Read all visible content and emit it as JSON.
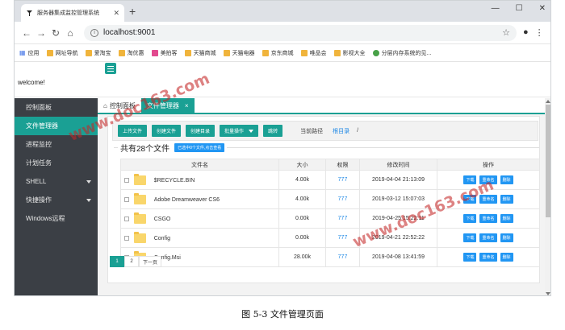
{
  "browser": {
    "tab_title": "服务器集成监控管理系统",
    "new_tab": "+",
    "url": "localhost:9001",
    "window_controls": [
      "—",
      "☐",
      "✕"
    ],
    "bookmarks": [
      {
        "label": "应用",
        "icon": "apps-grid-icon"
      },
      {
        "label": "网址导航",
        "icon": "folder-icon"
      },
      {
        "label": "爱淘宝",
        "icon": "folder-icon"
      },
      {
        "label": "淘优惠",
        "icon": "folder-icon"
      },
      {
        "label": "美拍客",
        "icon": "pink-square-icon"
      },
      {
        "label": "天猫商城",
        "icon": "folder-icon"
      },
      {
        "label": "天猫电器",
        "icon": "folder-icon"
      },
      {
        "label": "京东商城",
        "icon": "folder-icon"
      },
      {
        "label": "唯品会",
        "icon": "folder-icon"
      },
      {
        "label": "影视大全",
        "icon": "folder-icon"
      },
      {
        "label": "分层内存系统的见...",
        "icon": "green-circle-icon"
      }
    ]
  },
  "header": {
    "welcome": "welcome!"
  },
  "sidebar": {
    "items": [
      {
        "label": "控制面板"
      },
      {
        "label": "文件管理器"
      },
      {
        "label": "进程监控"
      },
      {
        "label": "计划任务"
      },
      {
        "label": "SHELL"
      },
      {
        "label": "快捷操作"
      },
      {
        "label": "Windows远程"
      }
    ]
  },
  "page_tabs": [
    {
      "label": "控制面板",
      "icon": "home-icon"
    },
    {
      "label": "文件管理器",
      "close": "×"
    }
  ],
  "toolbar": {
    "upload": "上传文件",
    "create_file": "创建文件",
    "create_dir": "创建目录",
    "batch": "批量操作",
    "jump": "跳转",
    "path_label": "当前路径",
    "path_root": "根目录",
    "path_sep": "/"
  },
  "listing": {
    "title": "共有28个文件",
    "selected_badge": "已选中0个文件,点击查看",
    "columns": [
      "文件名",
      "大小",
      "权限",
      "修改时间",
      "操作"
    ],
    "rows": [
      {
        "name": "$RECYCLE.BIN",
        "size": "4.00k",
        "perm": "777",
        "mtime": "2019-04-04 21:13:09"
      },
      {
        "name": "Adobe Dreamweaver CS6",
        "size": "4.00k",
        "perm": "777",
        "mtime": "2019-03-12 15:07:03"
      },
      {
        "name": "CSGO",
        "size": "0.00k",
        "perm": "777",
        "mtime": "2019-04-25 15:22:11"
      },
      {
        "name": "Config",
        "size": "0.00k",
        "perm": "777",
        "mtime": "2019-04-21 22:52:22"
      },
      {
        "name": "Config.Msi",
        "size": "28.00k",
        "perm": "777",
        "mtime": "2019-04-08 13:41:59"
      }
    ],
    "actions": [
      "下载",
      "重命名",
      "删除"
    ]
  },
  "pager": {
    "pages": [
      "1",
      "2"
    ],
    "next": "下一页"
  },
  "watermark": "www.doc163.com",
  "caption": "图  5-3  文件管理页面"
}
